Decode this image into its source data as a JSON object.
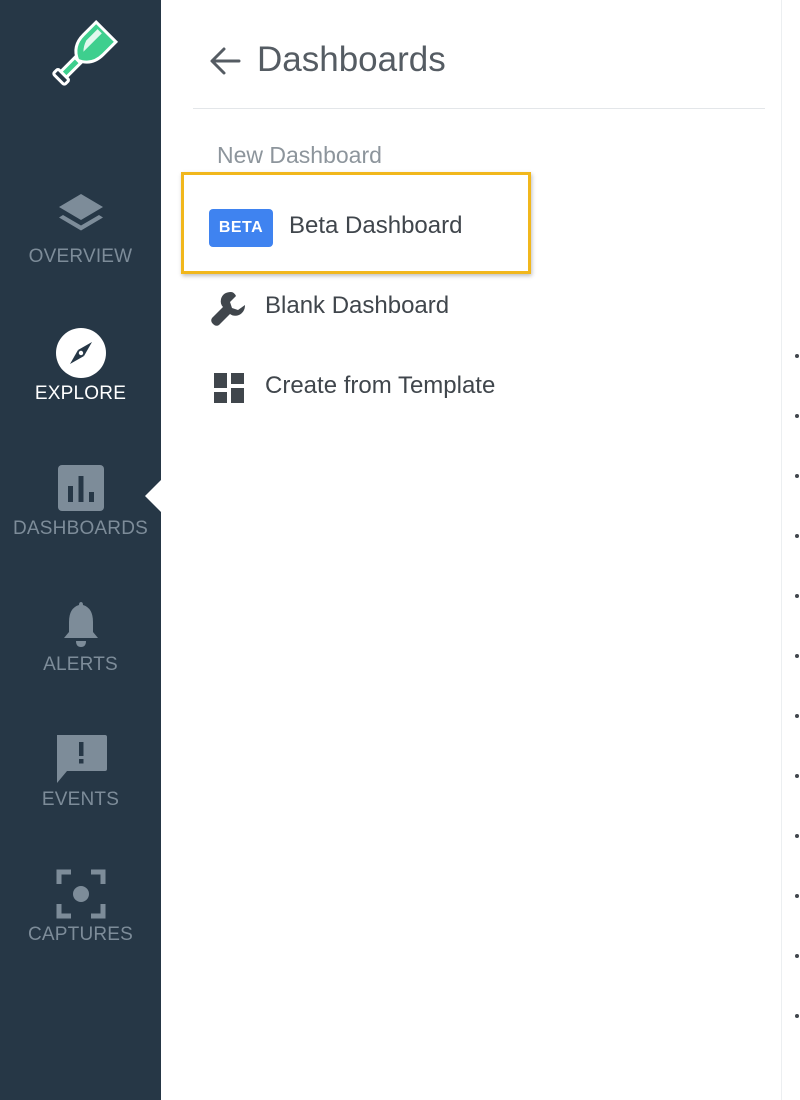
{
  "sidebar": {
    "items": [
      {
        "label": "OVERVIEW",
        "icon": "layers-icon",
        "active": false
      },
      {
        "label": "EXPLORE",
        "icon": "compass-icon",
        "active": true
      },
      {
        "label": "DASHBOARDS",
        "icon": "bar-chart-icon",
        "active": false
      },
      {
        "label": "ALERTS",
        "icon": "bell-icon",
        "active": false
      },
      {
        "label": "EVENTS",
        "icon": "alert-message-icon",
        "active": false
      },
      {
        "label": "CAPTURES",
        "icon": "capture-icon",
        "active": false
      }
    ]
  },
  "panel": {
    "title": "Dashboards",
    "section_label": "New Dashboard",
    "items": [
      {
        "label": "Beta Dashboard",
        "badge": "BETA",
        "highlighted": true
      },
      {
        "label": "Blank Dashboard",
        "icon": "wrench-icon"
      },
      {
        "label": "Create from Template",
        "icon": "template-grid-icon"
      }
    ]
  },
  "colors": {
    "sidebar_bg": "#263746",
    "badge_blue": "#3f83f0",
    "highlight_border": "#f1b71c",
    "logo_green": "#3ecf8e"
  }
}
